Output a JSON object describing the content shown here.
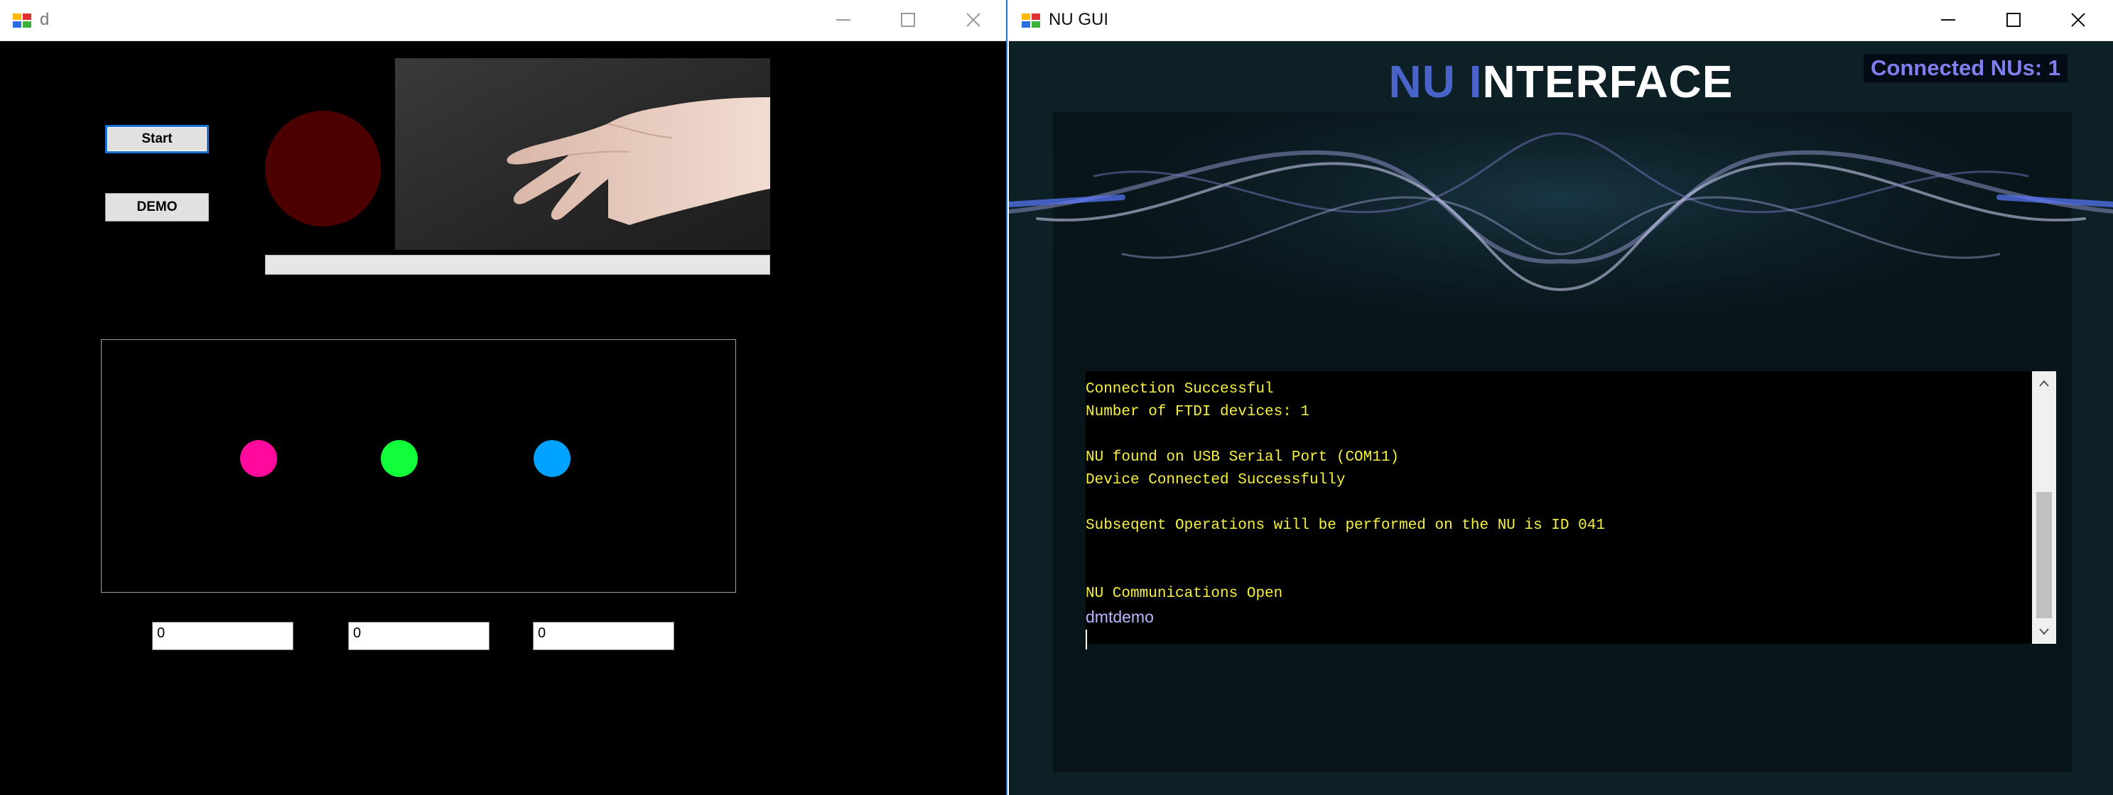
{
  "left_window": {
    "title": "d",
    "start_button": "Start",
    "demo_button": "DEMO",
    "progress_value": 0,
    "dot_colors": [
      "#ff0a9c",
      "#11ff3a",
      "#00a2ff"
    ],
    "textboxes": [
      "0",
      "0",
      "0"
    ]
  },
  "right_window": {
    "title": "NU GUI",
    "brand_part1": "NU I",
    "brand_part2": "NTERFACE",
    "connected_label": "Connected NUs: 1",
    "console_lines": [
      "Connection Successful",
      "Number of FTDI devices: 1",
      "",
      "NU found on USB Serial Port (COM11)",
      "Device Connected Successfully",
      "",
      "Subseqent Operations will be performed on the NU is ID 041",
      "",
      "",
      "NU Communications Open"
    ],
    "console_input_echo": "dmtdemo"
  }
}
